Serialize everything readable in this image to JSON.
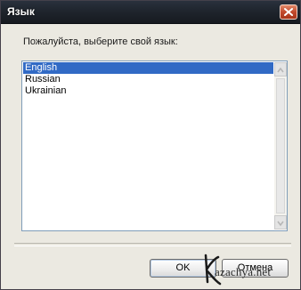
{
  "window": {
    "title": "Язык"
  },
  "dialog": {
    "prompt": "Пожалуйста, выберите свой язык:",
    "languages": [
      {
        "label": "English",
        "selected": true
      },
      {
        "label": "Russian",
        "selected": false
      },
      {
        "label": "Ukrainian",
        "selected": false
      }
    ],
    "ok_label": "OK",
    "cancel_label": "Отмена"
  },
  "watermark": {
    "text": "azachya.net"
  },
  "colors": {
    "selection": "#316ac5",
    "titlebar": "#20262f",
    "close_button": "#c2492c"
  },
  "icons": {
    "close": "close-icon",
    "scroll_up": "chevron-up-icon",
    "scroll_down": "chevron-down-icon"
  }
}
